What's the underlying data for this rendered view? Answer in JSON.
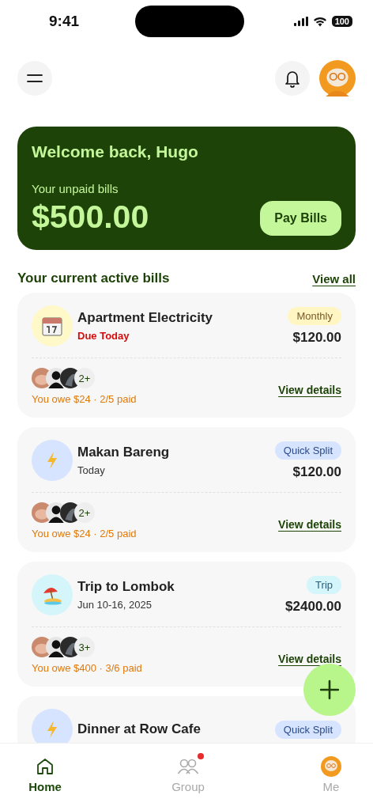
{
  "status_bar": {
    "time": "9:41",
    "battery": "100"
  },
  "summary": {
    "greeting": "Welcome back, Hugo",
    "label": "Your unpaid bills",
    "amount": "$500.00",
    "button": "Pay Bills"
  },
  "section": {
    "title": "Your current active bills",
    "link": "View all"
  },
  "bills": [
    {
      "kind": "monthly",
      "title": "Apartment Electricity",
      "subtitle": "Due Today",
      "urgent": true,
      "tag": "Monthly",
      "amount": "$120.00",
      "more": "2+",
      "owe": "You owe $24 · 2/5 paid",
      "link": "View details"
    },
    {
      "kind": "quick_split",
      "title": "Makan Bareng",
      "subtitle": "Today",
      "urgent": false,
      "tag": "Quick Split",
      "amount": "$120.00",
      "more": "2+",
      "owe": "You owe $24 · 2/5 paid",
      "link": "View details"
    },
    {
      "kind": "trip",
      "title": "Trip to Lombok",
      "subtitle": "Jun 10-16, 2025",
      "urgent": false,
      "tag": "Trip",
      "amount": "$2400.00",
      "more": "3+",
      "owe": "You owe $400 · 3/6 paid",
      "link": "View details"
    },
    {
      "kind": "quick_split",
      "title": "Dinner at Row Cafe",
      "tag": "Quick Split"
    }
  ],
  "nav": [
    {
      "kind": "home",
      "label": "Home",
      "selected": true,
      "badge": false
    },
    {
      "kind": "group",
      "label": "Group",
      "selected": false,
      "badge": true
    },
    {
      "kind": "profile",
      "label": "Me",
      "selected": false,
      "badge": false
    }
  ]
}
